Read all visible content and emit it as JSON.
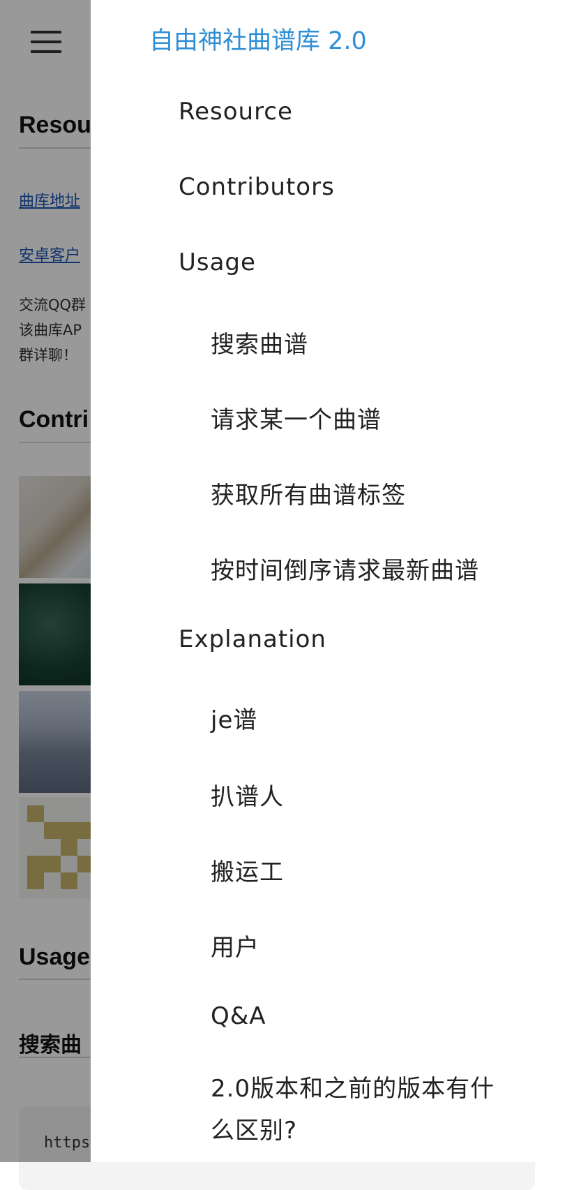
{
  "background": {
    "sections": {
      "resource_heading": "Resou",
      "contributors_heading": "Contri",
      "usage_heading": "Usage",
      "search_heading": "搜索曲"
    },
    "links": {
      "library_address": "曲库地址",
      "android_client": "安卓客户"
    },
    "paragraph_lines": [
      "交流QQ群",
      "该曲库AP",
      "群详聊！"
    ],
    "code_snippet": "https"
  },
  "drawer": {
    "title": "自由神社曲谱库 2.0",
    "items": [
      {
        "label": "Resource",
        "level": 1
      },
      {
        "label": "Contributors",
        "level": 1
      },
      {
        "label": "Usage",
        "level": 1
      },
      {
        "label": "搜索曲谱",
        "level": 2
      },
      {
        "label": "请求某一个曲谱",
        "level": 2
      },
      {
        "label": "获取所有曲谱标签",
        "level": 2
      },
      {
        "label": "按时间倒序请求最新曲谱",
        "level": 2
      },
      {
        "label": "Explanation",
        "level": 1
      },
      {
        "label": "je谱",
        "level": 2
      },
      {
        "label": "扒谱人",
        "level": 2
      },
      {
        "label": "搬运工",
        "level": 2
      },
      {
        "label": "用户",
        "level": 2
      },
      {
        "label": "Q&A",
        "level": 2
      },
      {
        "label": "2.0版本和之前的版本有什么区别?",
        "level": 2
      }
    ]
  },
  "colors": {
    "accent": "#2f8fd6",
    "link": "#1a55b5",
    "scrim": "rgba(0,0,0,0.4)"
  },
  "icons": {
    "menu": "hamburger-menu-icon"
  }
}
